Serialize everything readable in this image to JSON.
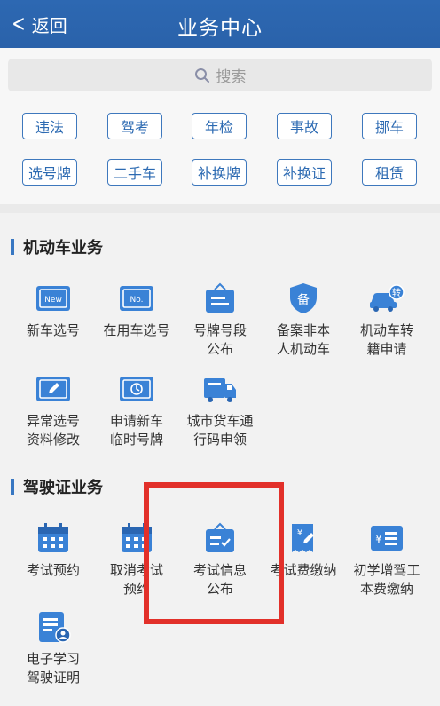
{
  "header": {
    "back_label": "返回",
    "title": "业务中心"
  },
  "search": {
    "placeholder": "搜索"
  },
  "quick_chips": [
    [
      "违法",
      "驾考",
      "年检",
      "事故",
      "挪车"
    ],
    [
      "选号牌",
      "二手车",
      "补换牌",
      "补换证",
      "租赁"
    ]
  ],
  "sections": [
    {
      "title": "机动车业务",
      "items": [
        {
          "line1": "新车选号",
          "line2": "",
          "icon": "new-plate-icon"
        },
        {
          "line1": "在用车选号",
          "line2": "",
          "icon": "no-plate-icon"
        },
        {
          "line1": "号牌号段",
          "line2": "公布",
          "icon": "notice-board-icon"
        },
        {
          "line1": "备案非本",
          "line2": "人机动车",
          "icon": "record-shield-icon"
        },
        {
          "line1": "机动车转",
          "line2": "籍申请",
          "icon": "car-transfer-icon"
        },
        {
          "line1": "异常选号",
          "line2": "资料修改",
          "icon": "edit-plate-icon"
        },
        {
          "line1": "申请新车",
          "line2": "临时号牌",
          "icon": "temporary-plate-icon"
        },
        {
          "line1": "城市货车通",
          "line2": "行码申领",
          "icon": "truck-icon"
        }
      ]
    },
    {
      "title": "驾驶证业务",
      "items": [
        {
          "line1": "考试预约",
          "line2": "",
          "icon": "calendar-icon"
        },
        {
          "line1": "取消考试",
          "line2": "预约",
          "icon": "calendar-cancel-icon"
        },
        {
          "line1": "考试信息",
          "line2": "公布",
          "icon": "exam-notice-icon"
        },
        {
          "line1": "考试费缴纳",
          "line2": "",
          "icon": "fee-receipt-icon"
        },
        {
          "line1": "初学增驾工",
          "line2": "本费缴纳",
          "icon": "yen-list-icon"
        },
        {
          "line1": "电子学习",
          "line2": "驾驶证明",
          "icon": "e-certificate-icon"
        }
      ]
    }
  ],
  "colors": {
    "header": "#2d68b2",
    "accent": "#3877c2",
    "highlight": "#e2302a"
  }
}
